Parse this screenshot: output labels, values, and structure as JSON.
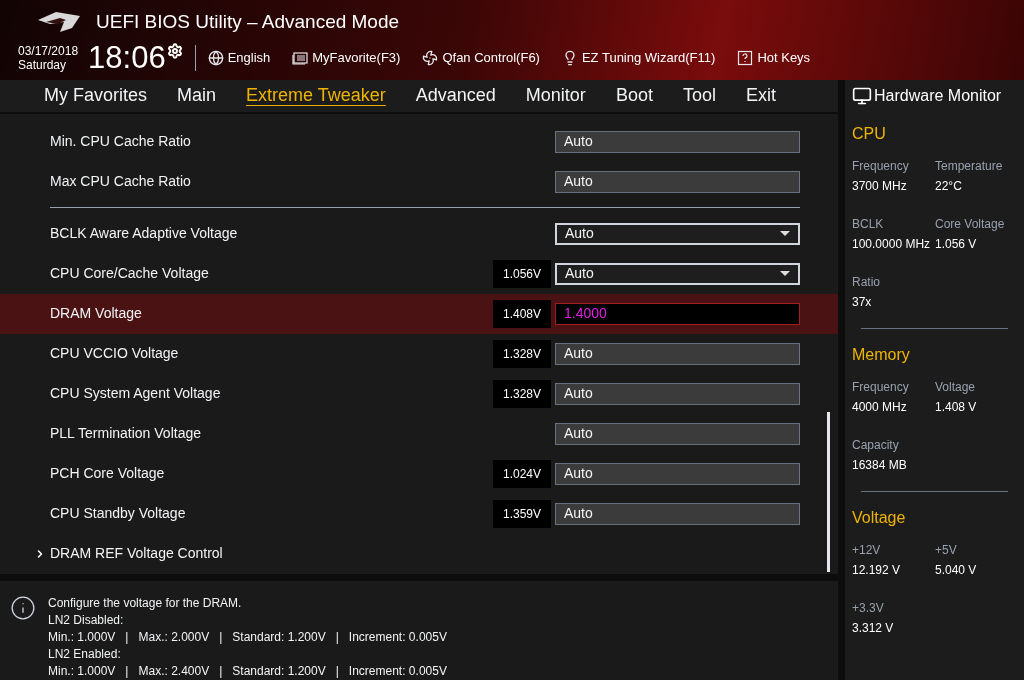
{
  "header": {
    "title": "UEFI BIOS Utility – Advanced Mode",
    "date": "03/17/2018",
    "day": "Saturday",
    "time": "18:06",
    "tools": [
      {
        "kind": "language",
        "label": "English"
      },
      {
        "kind": "favorite",
        "label": "MyFavorite(F3)"
      },
      {
        "kind": "fan",
        "label": "Qfan Control(F6)"
      },
      {
        "kind": "wizard",
        "label": "EZ Tuning Wizard(F11)"
      },
      {
        "kind": "hotkeys",
        "label": "Hot Keys"
      }
    ]
  },
  "tabs": [
    {
      "label": "My Favorites",
      "selected": false
    },
    {
      "label": "Main",
      "selected": false
    },
    {
      "label": "Extreme Tweaker",
      "selected": true
    },
    {
      "label": "Advanced",
      "selected": false
    },
    {
      "label": "Monitor",
      "selected": false
    },
    {
      "label": "Boot",
      "selected": false
    },
    {
      "label": "Tool",
      "selected": false
    },
    {
      "label": "Exit",
      "selected": false
    }
  ],
  "settings": [
    {
      "kind": "option",
      "label": "Min. CPU Cache Ratio",
      "value": "Auto",
      "selected": false
    },
    {
      "kind": "option",
      "label": "Max CPU Cache Ratio",
      "value": "Auto",
      "selected": false
    },
    {
      "kind": "divider"
    },
    {
      "kind": "dropdown",
      "label": "BCLK Aware Adaptive Voltage",
      "value": "Auto",
      "selected": false
    },
    {
      "kind": "dropdown",
      "label": "CPU Core/Cache Voltage",
      "reading": "1.056V",
      "value": "Auto",
      "selected": false
    },
    {
      "kind": "input",
      "label": "DRAM Voltage",
      "reading": "1.408V",
      "value": "1.4000",
      "selected": true
    },
    {
      "kind": "option",
      "label": "CPU VCCIO Voltage",
      "reading": "1.328V",
      "value": "Auto",
      "selected": false
    },
    {
      "kind": "option",
      "label": "CPU System Agent Voltage",
      "reading": "1.328V",
      "value": "Auto",
      "selected": false
    },
    {
      "kind": "option",
      "label": "PLL Termination Voltage",
      "value": "Auto",
      "selected": false
    },
    {
      "kind": "option",
      "label": "PCH Core Voltage",
      "reading": "1.024V",
      "value": "Auto",
      "selected": false
    },
    {
      "kind": "option",
      "label": "CPU Standby Voltage",
      "reading": "1.359V",
      "value": "Auto",
      "selected": false
    },
    {
      "kind": "submenu",
      "label": "DRAM REF Voltage Control",
      "selected": false
    }
  ],
  "help": {
    "lines": [
      "Configure the voltage for the DRAM.",
      "LN2 Disabled:",
      "Min.: 1.000V   |   Max.: 2.000V   |   Standard: 1.200V   |   Increment: 0.005V",
      "LN2 Enabled:",
      "Min.: 1.000V   |   Max.: 2.400V   |   Standard: 1.200V   |   Increment: 0.005V"
    ]
  },
  "hardware_monitor": {
    "title": "Hardware Monitor",
    "sections": [
      {
        "title": "CPU",
        "items": [
          {
            "label": "Frequency",
            "value": "3700 MHz"
          },
          {
            "label": "Temperature",
            "value": "22°C"
          },
          {
            "label": "BCLK",
            "value": "100.0000 MHz"
          },
          {
            "label": "Core Voltage",
            "value": "1.056 V"
          },
          {
            "label": "Ratio",
            "value": "37x"
          }
        ]
      },
      {
        "title": "Memory",
        "items": [
          {
            "label": "Frequency",
            "value": "4000 MHz"
          },
          {
            "label": "Voltage",
            "value": "1.408 V"
          },
          {
            "label": "Capacity",
            "value": "16384 MB"
          }
        ]
      },
      {
        "title": "Voltage",
        "items": [
          {
            "label": "+12V",
            "value": "12.192 V"
          },
          {
            "label": "+5V",
            "value": "5.040 V"
          },
          {
            "label": "+3.3V",
            "value": "3.312 V"
          }
        ]
      }
    ]
  }
}
